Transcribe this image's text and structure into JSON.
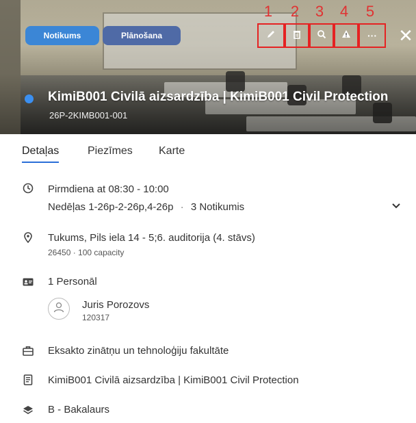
{
  "header": {
    "badges": {
      "event": "Notikums",
      "planning": "Plānošana"
    },
    "toolbar": {
      "numbers": [
        "1",
        "2",
        "3",
        "4",
        "5"
      ],
      "icons": [
        "edit-icon",
        "delete-icon",
        "search-icon",
        "warning-icon",
        "more-icon"
      ],
      "more_label": "···"
    },
    "close_label": "✕",
    "title": "KimiB001 Civilā aizsardzība | KimiB001 Civil Protection",
    "subtitle": "26P-2KIMB001-001",
    "status_color": "#3b8ff0"
  },
  "tabs": [
    "Detaļas",
    "Piezīmes",
    "Karte"
  ],
  "details": {
    "schedule": {
      "time": "Pirmdiena at 08:30 - 10:00",
      "weeks": "Nedēļas 1-26p-2-26p,4-26p",
      "separator": "·",
      "count": "3 Notikumis"
    },
    "location": {
      "name": "Tukums, Pils iela 14 - 5;6. auditorija (4. stāvs)",
      "meta": "26450 · 100 capacity"
    },
    "staff": {
      "count_label": "1 Personāl",
      "person_name": "Juris Porozovs",
      "person_id": "120317"
    },
    "faculty": "Eksakto zinātņu un tehnoloģiju fakultāte",
    "module": "KimiB001 Civilā aizsardzība | KimiB001 Civil Protection",
    "level": "B - Bakalaurs"
  },
  "colors": {
    "accent": "#2a6ed8",
    "highlight": "#e52222",
    "event_badge": "#3b86d6",
    "planning_badge": "#4f6aa6"
  }
}
